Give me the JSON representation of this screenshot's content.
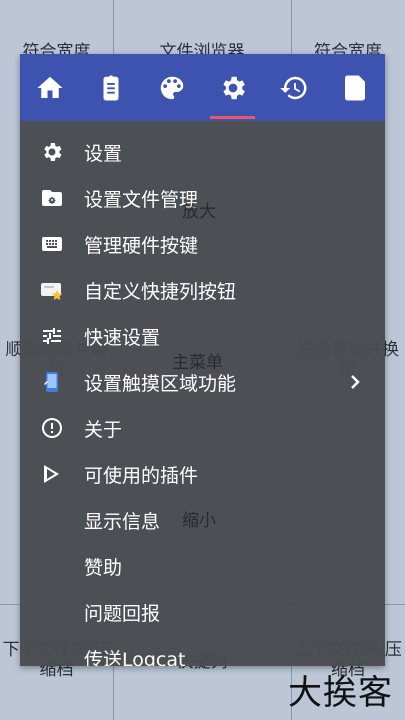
{
  "background_zones": {
    "top_left": "符合宽度",
    "top_center": "文件浏览器",
    "top_right": "符合宽度",
    "center_top": "放大",
    "middle_left": "顺向卷动并换页",
    "middle_center": "主菜单",
    "middle_right": "逆向卷动并换页",
    "center_bottom": "缩小",
    "bottom_left": "下个文件夹/压缩档",
    "bottom_center": "快捷列",
    "bottom_right": "上个文件夹/压缩档"
  },
  "toolbar": {
    "tabs": [
      {
        "icon": "home-icon"
      },
      {
        "icon": "clipboard-icon"
      },
      {
        "icon": "palette-icon"
      },
      {
        "icon": "gear-icon",
        "active": true
      },
      {
        "icon": "history-icon"
      },
      {
        "icon": "bookmark-file-icon"
      }
    ]
  },
  "menu": {
    "items": [
      {
        "label": "设置",
        "icon": "gear-icon"
      },
      {
        "label": "设置文件管理",
        "icon": "folder-gear-icon"
      },
      {
        "label": "管理硬件按键",
        "icon": "keyboard-icon"
      },
      {
        "label": "自定义快捷列按钮",
        "icon": "star-card-icon"
      },
      {
        "label": "快速设置",
        "icon": "sliders-icon"
      },
      {
        "label": "设置触摸区域功能",
        "icon": "phone-touch-icon",
        "has_submenu": true
      },
      {
        "label": "关于",
        "icon": "info-icon"
      },
      {
        "label": "可使用的插件",
        "icon": "play-plugin-icon"
      },
      {
        "label": "显示信息",
        "icon": ""
      },
      {
        "label": "赞助",
        "icon": ""
      },
      {
        "label": "问题回报",
        "icon": ""
      },
      {
        "label": "传送Logcat",
        "icon": ""
      }
    ]
  },
  "watermark": "大挨客",
  "colors": {
    "topbar": "#3e52b0",
    "panel": "#484b50",
    "active_indicator": "#e8586a",
    "background": "#bcc6d6"
  }
}
